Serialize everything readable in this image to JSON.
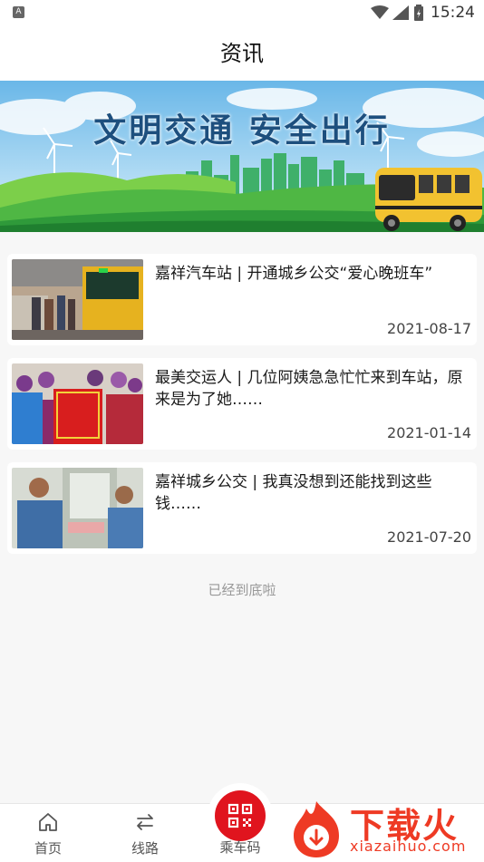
{
  "status_bar": {
    "time": "15:24",
    "left_icon": "A"
  },
  "header": {
    "title": "资讯"
  },
  "banner": {
    "slogan": "文明交通  安全出行"
  },
  "news": [
    {
      "title": "嘉祥汽车站 | 开通城乡公交“爱心晚班车”",
      "date": "2021-08-17"
    },
    {
      "title": "最美交运人 | 几位阿姨急急忙忙来到车站，原来是为了她……",
      "date": "2021-01-14"
    },
    {
      "title": "嘉祥城乡公交 | 我真没想到还能找到这些钱……",
      "date": "2021-07-20"
    }
  ],
  "list_end": "已经到底啦",
  "tabs": [
    {
      "label": "首页",
      "icon": "home-icon"
    },
    {
      "label": "线路",
      "icon": "route-icon"
    },
    {
      "label": "乘车码",
      "icon": "qr-code-icon"
    }
  ],
  "watermark": {
    "text": "下载火",
    "url": "xiazaihuo.com"
  },
  "colors": {
    "accent": "#e0141e",
    "watermark": "#ee3a24"
  }
}
